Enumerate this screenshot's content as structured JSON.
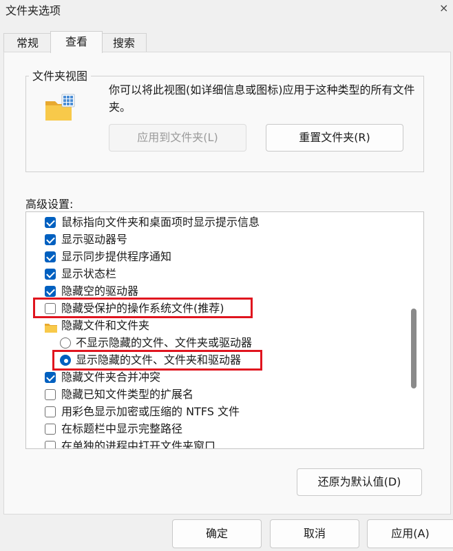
{
  "window": {
    "title": "文件夹选项",
    "close_glyph": "×"
  },
  "tabs": [
    {
      "label": "常规"
    },
    {
      "label": "查看"
    },
    {
      "label": "搜索"
    }
  ],
  "folder_views": {
    "title": "文件夹视图",
    "description": "你可以将此视图(如详细信息或图标)应用于这种类型的所有文件夹。",
    "apply_button": "应用到文件夹(L)",
    "reset_button": "重置文件夹(R)"
  },
  "advanced": {
    "label": "高级设置:",
    "items": [
      {
        "type": "checkbox",
        "checked": true,
        "label": "鼠标指向文件夹和桌面项时显示提示信息"
      },
      {
        "type": "checkbox",
        "checked": true,
        "label": "显示驱动器号"
      },
      {
        "type": "checkbox",
        "checked": true,
        "label": "显示同步提供程序通知"
      },
      {
        "type": "checkbox",
        "checked": true,
        "label": "显示状态栏"
      },
      {
        "type": "checkbox",
        "checked": true,
        "label": "隐藏空的驱动器"
      },
      {
        "type": "checkbox",
        "checked": false,
        "label": "隐藏受保护的操作系统文件(推荐)"
      },
      {
        "type": "folder",
        "label": "隐藏文件和文件夹"
      },
      {
        "type": "radio",
        "checked": false,
        "label": "不显示隐藏的文件、文件夹或驱动器"
      },
      {
        "type": "radio",
        "checked": true,
        "label": "显示隐藏的文件、文件夹和驱动器"
      },
      {
        "type": "checkbox",
        "checked": true,
        "label": "隐藏文件夹合并冲突"
      },
      {
        "type": "checkbox",
        "checked": false,
        "label": "隐藏已知文件类型的扩展名"
      },
      {
        "type": "checkbox",
        "checked": false,
        "label": "用彩色显示加密或压缩的 NTFS 文件"
      },
      {
        "type": "checkbox",
        "checked": false,
        "label": "在标题栏中显示完整路径"
      },
      {
        "type": "checkbox",
        "checked": false,
        "label": "在单独的进程中打开文件夹窗口"
      }
    ],
    "restore_button": "还原为默认值(D)"
  },
  "footer": {
    "ok": "确定",
    "cancel": "取消",
    "apply": "应用(A)"
  },
  "colors": {
    "accent": "#0060c0",
    "highlight_box": "#e0141e"
  }
}
